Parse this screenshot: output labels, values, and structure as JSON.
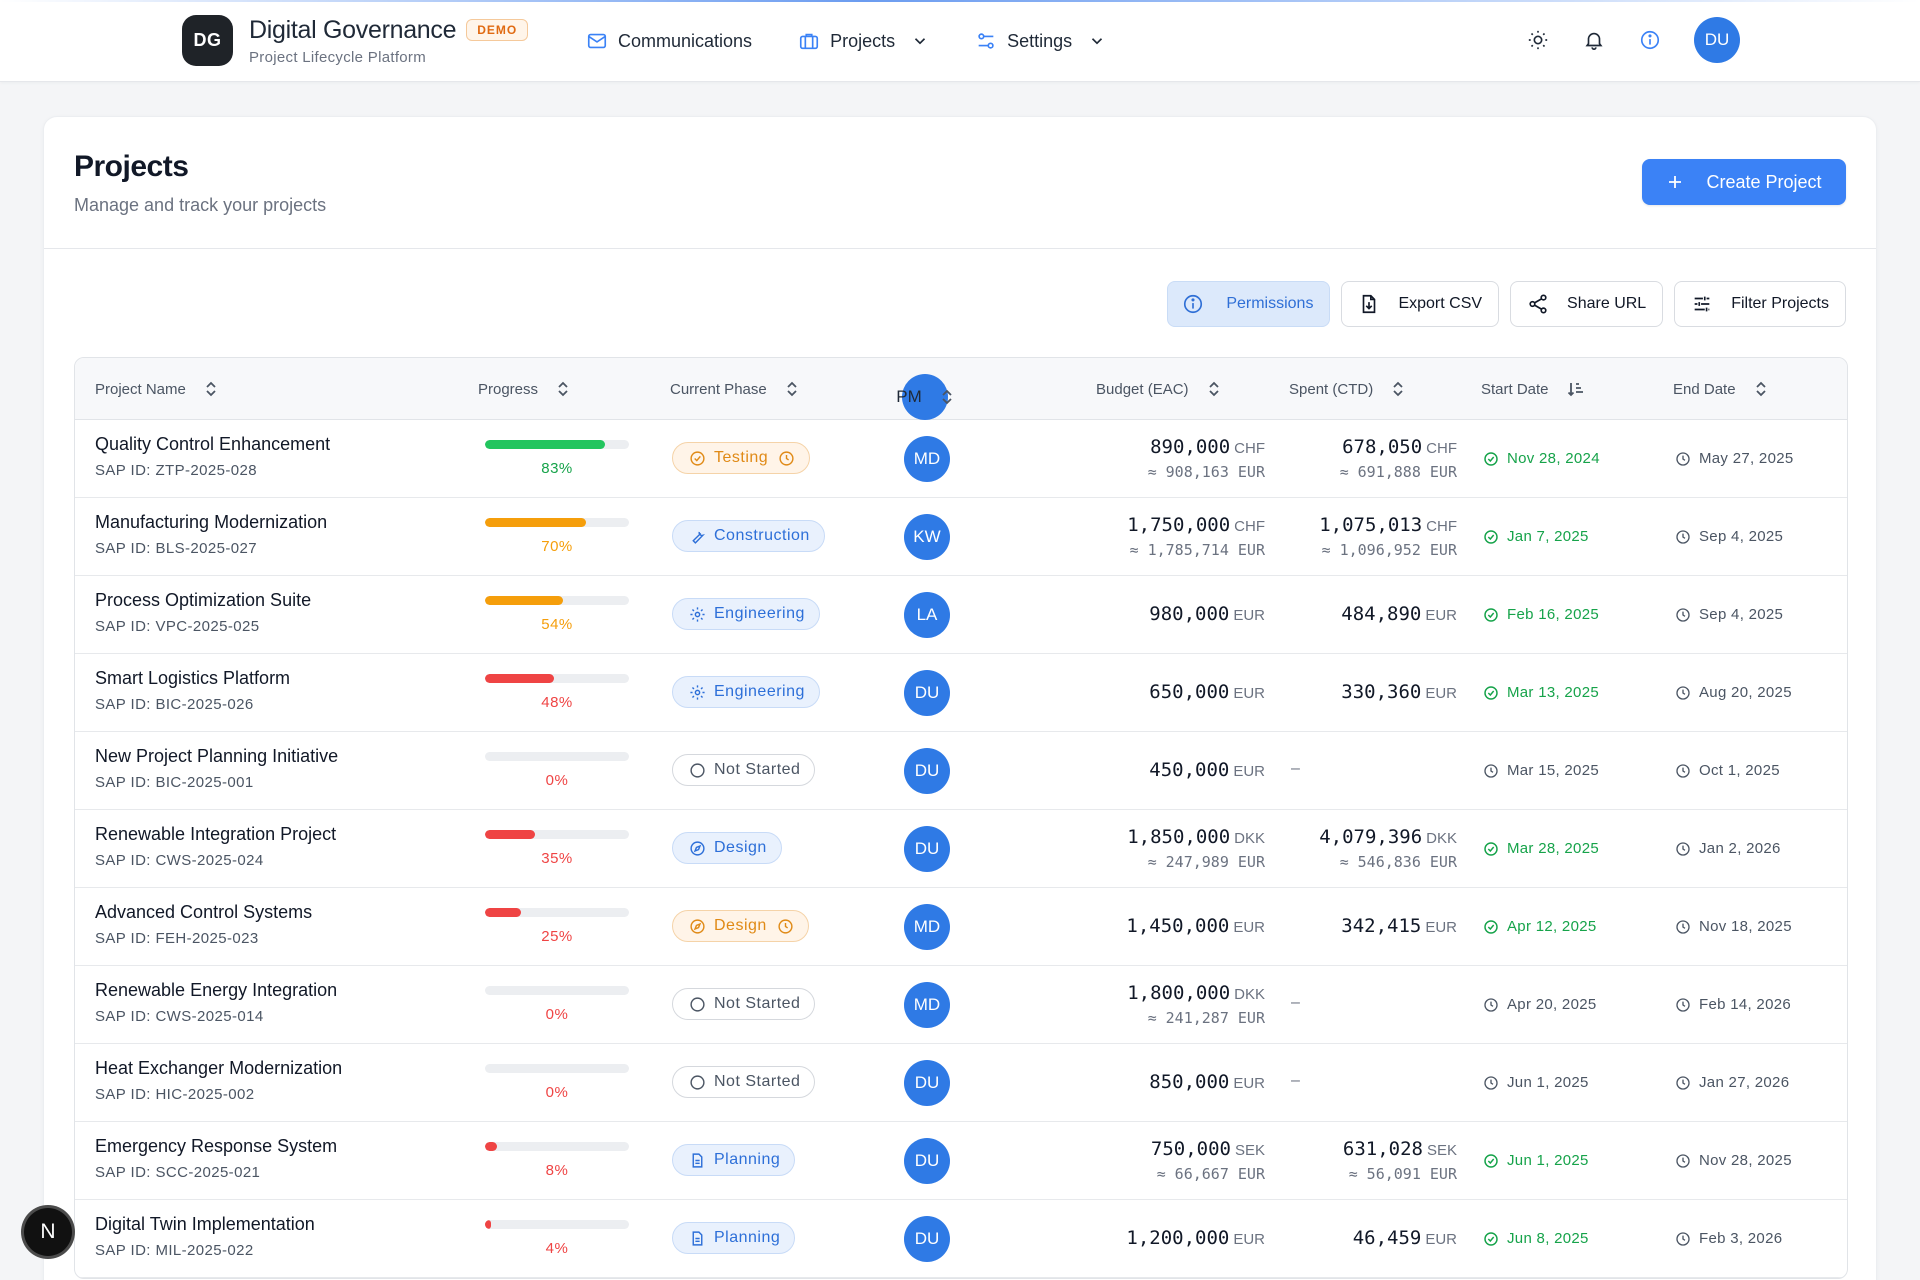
{
  "app": {
    "logo": "DG",
    "title": "Digital Governance",
    "badge": "DEMO",
    "subtitle": "Project Lifecycle Platform"
  },
  "nav": [
    {
      "label": "Communications",
      "icon": "mail-icon"
    },
    {
      "label": "Projects",
      "icon": "briefcase-icon",
      "dropdown": true
    },
    {
      "label": "Settings",
      "icon": "sliders-icon",
      "dropdown": true
    }
  ],
  "header_icons": [
    "sun-icon",
    "bell-icon",
    "info-icon"
  ],
  "user": {
    "initials": "DU"
  },
  "page": {
    "title": "Projects",
    "subtitle": "Manage and track your projects",
    "create_label": "Create Project"
  },
  "toolbar": {
    "permissions": "Permissions",
    "export": "Export CSV",
    "share": "Share URL",
    "filter": "Filter Projects"
  },
  "columns": {
    "name": "Project Name",
    "progress": "Progress",
    "phase": "Current Phase",
    "pm": "PM",
    "budget": "Budget (EAC)",
    "spent": "Spent (CTD)",
    "start": "Start Date",
    "end": "End Date"
  },
  "colors": {
    "primary": "#3b82f6",
    "green": "#22c55e",
    "orange": "#f59e0b",
    "red": "#ef4444",
    "pct_green": "#16a34a",
    "pct_orange": "#f59e0b",
    "pct_red": "#ef4444"
  },
  "rows": [
    {
      "name": "Quality Control Enhancement",
      "sap": "SAP ID: ZTP-2025-028",
      "progress": 0.83,
      "progress_label": "83%",
      "tone": "green",
      "phase": "Testing",
      "phase_style": "orange",
      "phase_icon": "check-circle-icon",
      "phase_clock": true,
      "pm": "MD",
      "budget": "890,000",
      "budget_cur": "CHF",
      "budget_conv": "≈ 908,163 EUR",
      "spent": "678,050",
      "spent_cur": "CHF",
      "spent_conv": "≈ 691,888 EUR",
      "start": "Nov 28, 2024",
      "start_state": "done",
      "end": "May 27, 2025"
    },
    {
      "name": "Manufacturing Modernization",
      "sap": "SAP ID: BLS-2025-027",
      "progress": 0.7,
      "progress_label": "70%",
      "tone": "orange",
      "phase": "Construction",
      "phase_style": "blue",
      "phase_icon": "wrench-icon",
      "phase_clock": false,
      "pm": "KW",
      "budget": "1,750,000",
      "budget_cur": "CHF",
      "budget_conv": "≈ 1,785,714 EUR",
      "spent": "1,075,013",
      "spent_cur": "CHF",
      "spent_conv": "≈ 1,096,952 EUR",
      "start": "Jan 7, 2025",
      "start_state": "done",
      "end": "Sep 4, 2025"
    },
    {
      "name": "Process Optimization Suite",
      "sap": "SAP ID: VPC-2025-025",
      "progress": 0.54,
      "progress_label": "54%",
      "tone": "orange",
      "phase": "Engineering",
      "phase_style": "blue",
      "phase_icon": "gear-icon",
      "phase_clock": false,
      "pm": "LA",
      "budget": "980,000",
      "budget_cur": "EUR",
      "budget_conv": "",
      "spent": "484,890",
      "spent_cur": "EUR",
      "spent_conv": "",
      "start": "Feb 16, 2025",
      "start_state": "done",
      "end": "Sep 4, 2025"
    },
    {
      "name": "Smart Logistics Platform",
      "sap": "SAP ID: BIC-2025-026",
      "progress": 0.48,
      "progress_label": "48%",
      "tone": "red",
      "phase": "Engineering",
      "phase_style": "blue",
      "phase_icon": "gear-icon",
      "phase_clock": false,
      "pm": "DU",
      "budget": "650,000",
      "budget_cur": "EUR",
      "budget_conv": "",
      "spent": "330,360",
      "spent_cur": "EUR",
      "spent_conv": "",
      "start": "Mar 13, 2025",
      "start_state": "done",
      "end": "Aug 20, 2025"
    },
    {
      "name": "New Project Planning Initiative",
      "sap": "SAP ID: BIC-2025-001",
      "progress": 0,
      "progress_label": "0%",
      "tone": "red",
      "phase": "Not Started",
      "phase_style": "gray",
      "phase_icon": "circle-icon",
      "phase_clock": false,
      "pm": "DU",
      "budget": "450,000",
      "budget_cur": "EUR",
      "budget_conv": "",
      "spent": "",
      "spent_cur": "",
      "spent_conv": "",
      "spent_dash": "–",
      "start": "Mar 15, 2025",
      "start_state": "pending",
      "end": "Oct 1, 2025"
    },
    {
      "name": "Renewable Integration Project",
      "sap": "SAP ID: CWS-2025-024",
      "progress": 0.35,
      "progress_label": "35%",
      "tone": "red",
      "phase": "Design",
      "phase_style": "blue",
      "phase_icon": "compass-icon",
      "phase_clock": false,
      "pm": "DU",
      "budget": "1,850,000",
      "budget_cur": "DKK",
      "budget_conv": "≈ 247,989 EUR",
      "spent": "4,079,396",
      "spent_cur": "DKK",
      "spent_conv": "≈ 546,836 EUR",
      "start": "Mar 28, 2025",
      "start_state": "done",
      "end": "Jan 2, 2026"
    },
    {
      "name": "Advanced Control Systems",
      "sap": "SAP ID: FEH-2025-023",
      "progress": 0.25,
      "progress_label": "25%",
      "tone": "red",
      "phase": "Design",
      "phase_style": "orange",
      "phase_icon": "compass-icon",
      "phase_clock": true,
      "pm": "MD",
      "budget": "1,450,000",
      "budget_cur": "EUR",
      "budget_conv": "",
      "spent": "342,415",
      "spent_cur": "EUR",
      "spent_conv": "",
      "start": "Apr 12, 2025",
      "start_state": "done",
      "end": "Nov 18, 2025"
    },
    {
      "name": "Renewable Energy Integration",
      "sap": "SAP ID: CWS-2025-014",
      "progress": 0,
      "progress_label": "0%",
      "tone": "red",
      "phase": "Not Started",
      "phase_style": "gray",
      "phase_icon": "circle-icon",
      "phase_clock": false,
      "pm": "MD",
      "budget": "1,800,000",
      "budget_cur": "DKK",
      "budget_conv": "≈ 241,287 EUR",
      "spent": "",
      "spent_cur": "",
      "spent_conv": "",
      "spent_dash": "–",
      "start": "Apr 20, 2025",
      "start_state": "pending",
      "end": "Feb 14, 2026"
    },
    {
      "name": "Heat Exchanger Modernization",
      "sap": "SAP ID: HIC-2025-002",
      "progress": 0,
      "progress_label": "0%",
      "tone": "red",
      "phase": "Not Started",
      "phase_style": "gray",
      "phase_icon": "circle-icon",
      "phase_clock": false,
      "pm": "DU",
      "budget": "850,000",
      "budget_cur": "EUR",
      "budget_conv": "",
      "spent": "",
      "spent_cur": "",
      "spent_conv": "",
      "spent_dash": "–",
      "start": "Jun 1, 2025",
      "start_state": "pending",
      "end": "Jan 27, 2026"
    },
    {
      "name": "Emergency Response System",
      "sap": "SAP ID: SCC-2025-021",
      "progress": 0.08,
      "progress_label": "8%",
      "tone": "red",
      "phase": "Planning",
      "phase_style": "blue",
      "phase_icon": "document-icon",
      "phase_clock": false,
      "pm": "DU",
      "budget": "750,000",
      "budget_cur": "SEK",
      "budget_conv": "≈ 66,667 EUR",
      "spent": "631,028",
      "spent_cur": "SEK",
      "spent_conv": "≈ 56,091 EUR",
      "start": "Jun 1, 2025",
      "start_state": "done",
      "end": "Nov 28, 2025"
    },
    {
      "name": "Digital Twin Implementation",
      "sap": "SAP ID: MIL-2025-022",
      "progress": 0.04,
      "progress_label": "4%",
      "tone": "red",
      "phase": "Planning",
      "phase_style": "blue",
      "phase_icon": "document-icon",
      "phase_clock": false,
      "pm": "DU",
      "budget": "1,200,000",
      "budget_cur": "EUR",
      "budget_conv": "",
      "spent": "46,459",
      "spent_cur": "EUR",
      "spent_conv": "",
      "start": "Jun 8, 2025",
      "start_state": "done",
      "end": "Feb 3, 2026"
    }
  ],
  "floating": {
    "label": "N"
  }
}
